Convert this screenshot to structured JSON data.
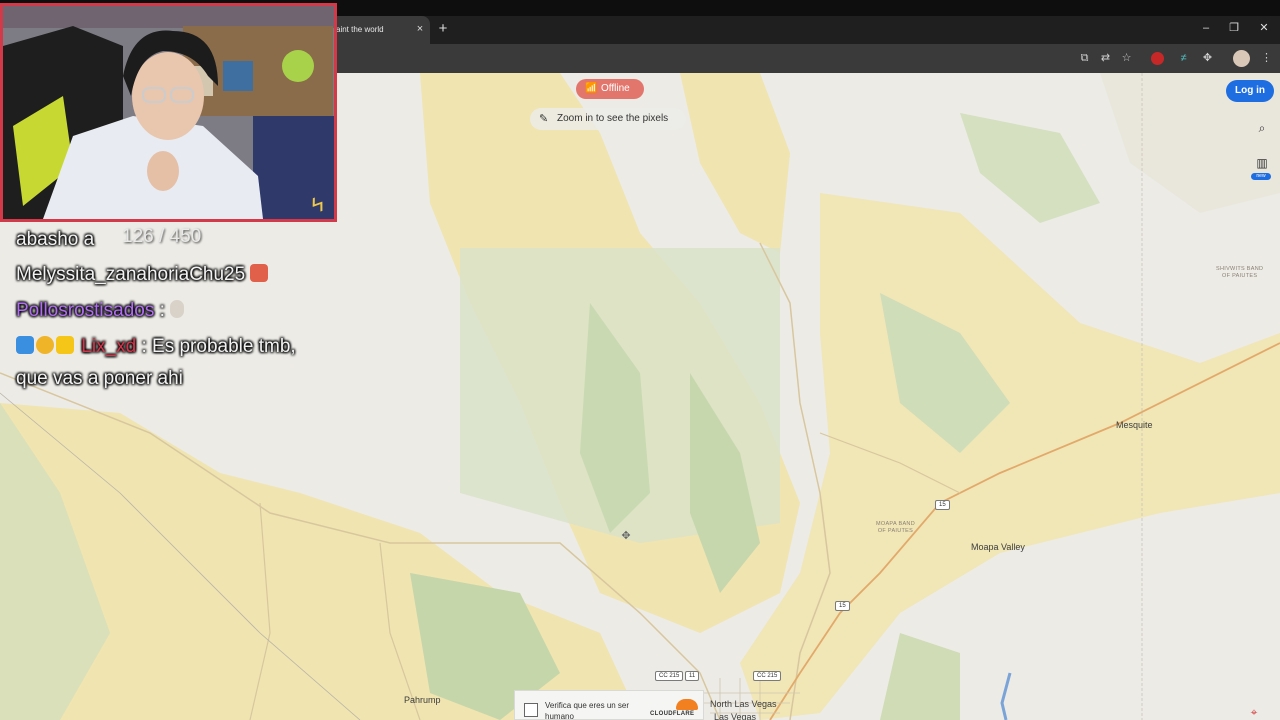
{
  "browser": {
    "tab_title": "aint the world",
    "tab_close": "×",
    "new_tab": "+",
    "window_controls": {
      "minimize": "–",
      "maximize": "❐",
      "close": "✕"
    }
  },
  "map": {
    "offline_label": "Offline",
    "offline_icon": "wifi-off-icon",
    "zoom_hint": "Zoom in to see the pixels",
    "login_label": "Log in",
    "new_badge": "new",
    "places": {
      "mesquite": "Mesquite",
      "moapa_valley": "Moapa Valley",
      "pahrump": "Pahrump",
      "north_las_vegas": "North Las Vegas",
      "las_vegas": "Las Vegas"
    },
    "small_labels": {
      "shivwits": "SHIVWITS BAND\nOF PAIUTES",
      "moapa_band": "MOAPA BAND\nOF PAIUTES"
    },
    "shields": {
      "i15_a": "15",
      "i15_b": "15",
      "cc215_a": "CC 215",
      "cc215_b": "CC 215",
      "i11": "11"
    }
  },
  "captcha": {
    "text": "Verifica que eres un ser humano",
    "provider": "CLOUDFLARE"
  },
  "chat": {
    "line1_text": "abasho a",
    "counter": "126 / 450",
    "line2_text": "Melyssita_zanahoriaChu25",
    "line3_user": "Pollosrostisados",
    "line3_sep": " :",
    "line4_user": "Lix_xd",
    "line4_text": " : Es probable tmb,",
    "line5_text": "que vas a poner ahi"
  },
  "colors": {
    "offline_pill": "#e2766c",
    "login_button": "#1e6ee2",
    "webcam_border": "#d23a4a",
    "chat_purple": "#b06cf2",
    "chat_red": "#d8334a"
  }
}
